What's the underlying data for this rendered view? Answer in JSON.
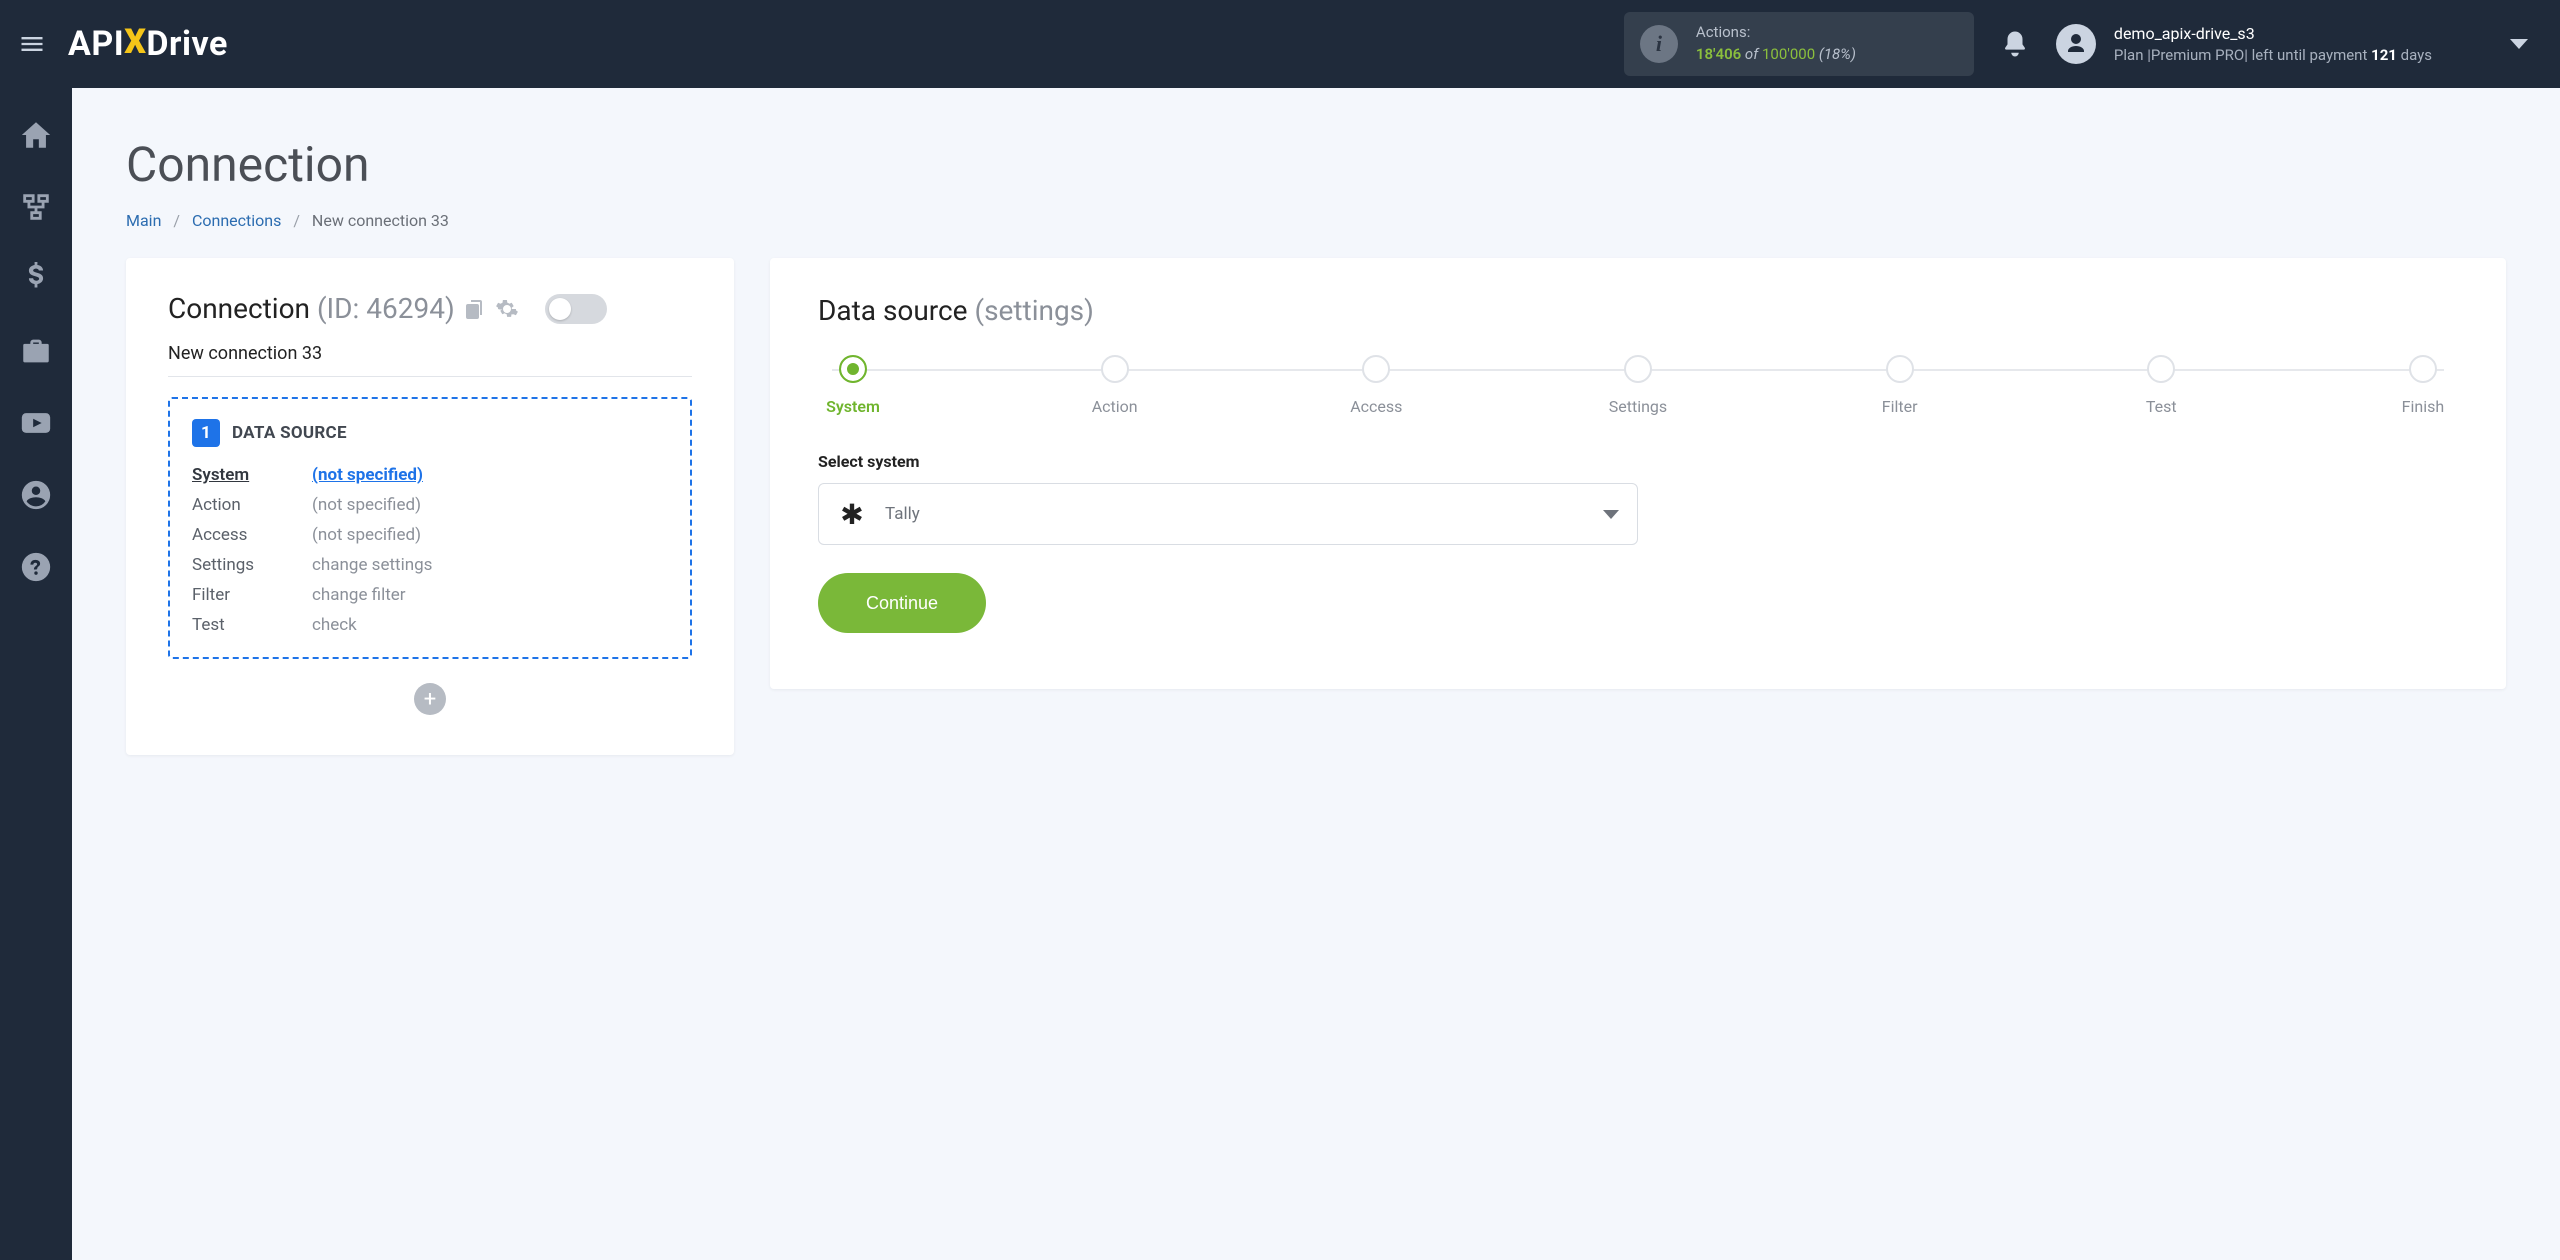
{
  "topbar": {
    "actions_label": "Actions:",
    "actions_count": "18'406",
    "actions_of": " of ",
    "actions_total": "100'000",
    "actions_pct": " (18%)",
    "user_name": "demo_apix-drive_s3",
    "user_plan_prefix": "Plan |Premium PRO| left until payment ",
    "user_plan_days": "121",
    "user_plan_suffix": " days"
  },
  "logo": {
    "p1": "API",
    "p2": "X",
    "p3": "Drive"
  },
  "page": {
    "title": "Connection",
    "breadcrumbs": {
      "main": "Main",
      "connections": "Connections",
      "current": "New connection 33"
    }
  },
  "left_card": {
    "title": "Connection ",
    "id_label": "(ID: 46294)",
    "conn_name": "New connection 33",
    "ds_badge": "1",
    "ds_title": "DATA SOURCE",
    "rows": {
      "system_k": "System",
      "system_v": "(not specified)",
      "action_k": "Action",
      "action_v": "(not specified)",
      "access_k": "Access",
      "access_v": "(not specified)",
      "settings_k": "Settings",
      "settings_v": "change settings",
      "filter_k": "Filter",
      "filter_v": "change filter",
      "test_k": "Test",
      "test_v": "check"
    },
    "plus": "+"
  },
  "right_card": {
    "title": "Data source ",
    "subtitle": "(settings)",
    "steps": {
      "s0": "System",
      "s1": "Action",
      "s2": "Access",
      "s3": "Settings",
      "s4": "Filter",
      "s5": "Test",
      "s6": "Finish"
    },
    "field_label": "Select system",
    "selected_system": "Tally",
    "continue": "Continue"
  }
}
